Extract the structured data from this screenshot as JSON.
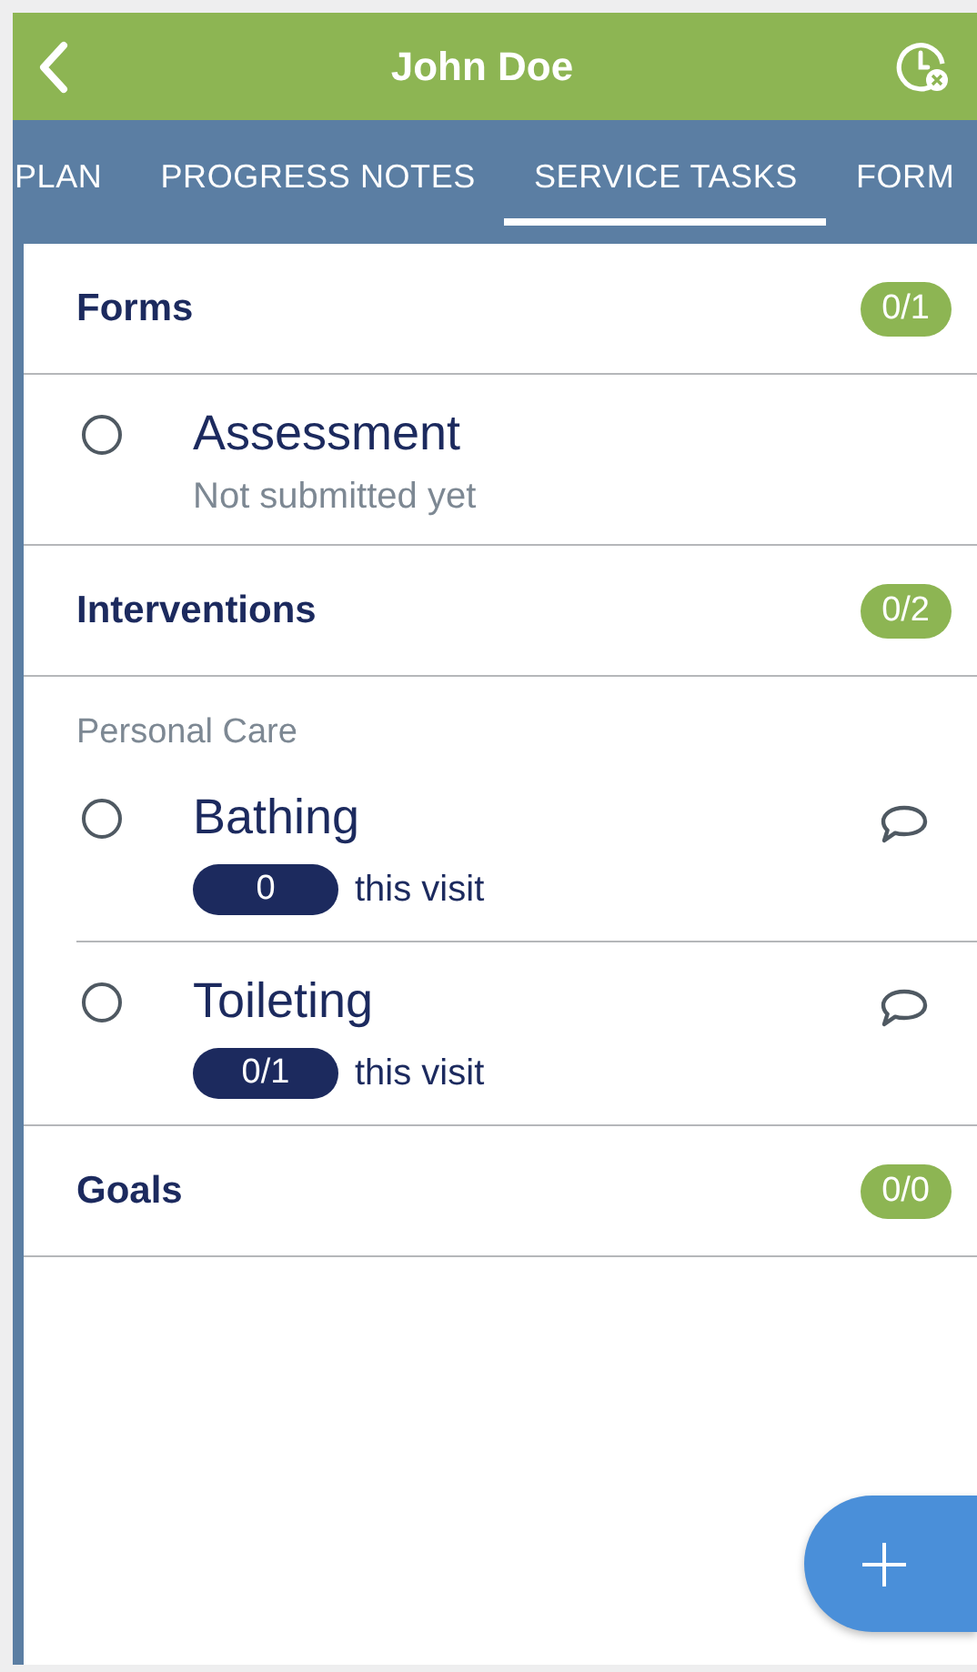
{
  "header": {
    "title": "John Doe"
  },
  "tabs": [
    {
      "label": "PLAN",
      "selected": false
    },
    {
      "label": "PROGRESS NOTES",
      "selected": false
    },
    {
      "label": "SERVICE TASKS",
      "selected": true
    },
    {
      "label": "FORM",
      "selected": false
    }
  ],
  "sections": [
    {
      "title": "Forms",
      "count": "0/1",
      "groups": [
        {
          "items": [
            {
              "kind": "form",
              "title": "Assessment",
              "checked": false,
              "status": "Not submitted yet"
            }
          ]
        }
      ]
    },
    {
      "title": "Interventions",
      "count": "0/2",
      "groups": [
        {
          "label": "Personal Care",
          "items": [
            {
              "kind": "intervention",
              "title": "Bathing",
              "checked": false,
              "count": "0",
              "count_label": "this visit"
            },
            {
              "kind": "intervention",
              "title": "Toileting",
              "checked": false,
              "count": "0/1",
              "count_label": "this visit"
            }
          ]
        }
      ]
    },
    {
      "title": "Goals",
      "count": "0/0"
    }
  ]
}
